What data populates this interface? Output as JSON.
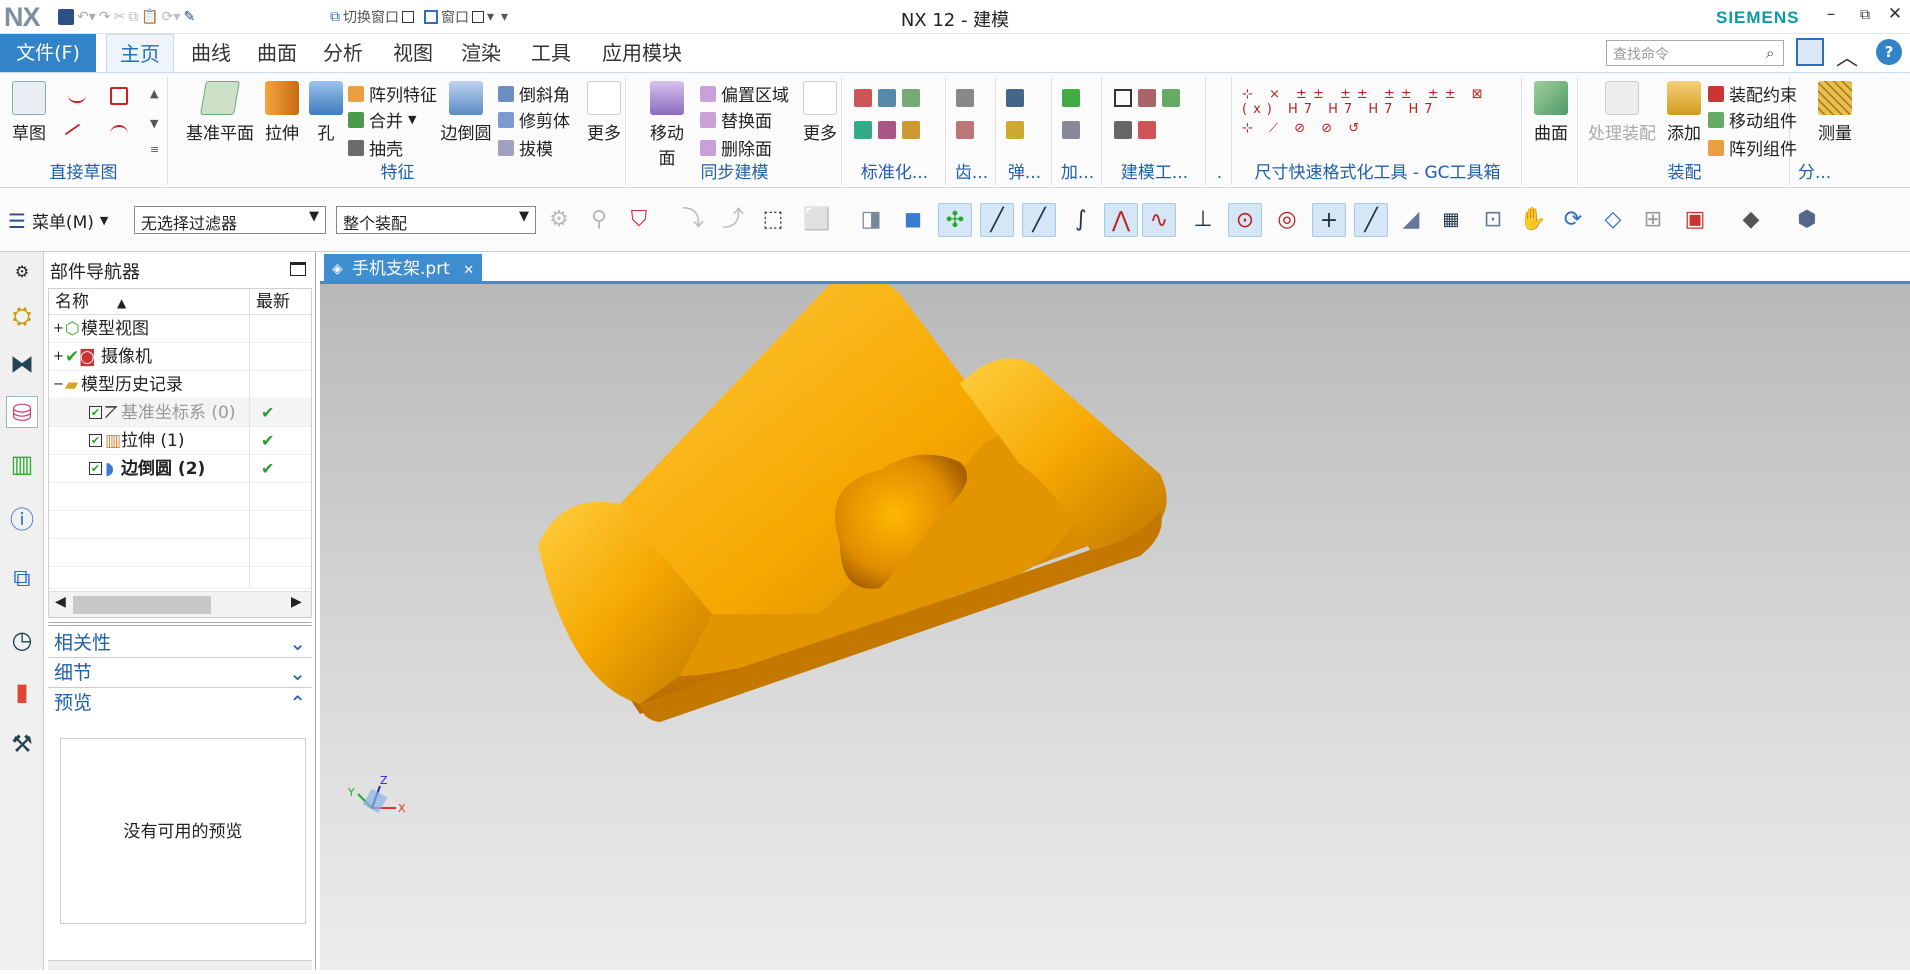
{
  "titlebar": {
    "logo": "NX",
    "title": "NX 12 - 建模",
    "switch_window": "切换窗口",
    "window": "窗口",
    "brand": "SIEMENS"
  },
  "menu": {
    "file": "文件(F)",
    "tabs": [
      "主页",
      "曲线",
      "曲面",
      "分析",
      "视图",
      "渲染",
      "工具",
      "应用模块"
    ],
    "search_placeholder": "查找命令"
  },
  "ribbon": {
    "sketch": {
      "btn": "草图",
      "group": "直接草图"
    },
    "feature": {
      "datum_plane": "基准平面",
      "extrude": "拉伸",
      "hole": "孔",
      "pattern_feature": "阵列特征",
      "unite": "合并",
      "shell": "抽壳",
      "edge_blend": "边倒圆",
      "chamfer": "倒斜角",
      "trim_body": "修剪体",
      "draft": "拔模",
      "more": "更多",
      "group": "特征"
    },
    "sync": {
      "move_face": "移动面",
      "offset_region": "偏置区域",
      "replace_face": "替换面",
      "delete_face": "删除面",
      "more": "更多",
      "group": "同步建模"
    },
    "groups_small": [
      "标准化...",
      "齿...",
      "弹...",
      "加...",
      "建模工...",
      ".",
      "尺寸快速格式化工具 - GC工具箱"
    ],
    "surface": {
      "btn": "曲面"
    },
    "assembly": {
      "process": "处理装配",
      "add": "添加",
      "constraint": "装配约束",
      "move_comp": "移动组件",
      "pattern_comp": "阵列组件",
      "group": "装配"
    },
    "analysis": {
      "measure": "测量",
      "group": "分..."
    }
  },
  "toolbar2": {
    "menu": "菜单(M)",
    "filter": "无选择过滤器",
    "scope": "整个装配"
  },
  "navigator": {
    "title": "部件导航器",
    "col_name": "名称",
    "col_latest": "最新",
    "items": [
      {
        "label": "模型视图",
        "latest": ""
      },
      {
        "label": "摄像机",
        "latest": ""
      },
      {
        "label": "模型历史记录",
        "latest": ""
      },
      {
        "label": "基准坐标系 (0)",
        "latest": "✔"
      },
      {
        "label": "拉伸 (1)",
        "latest": "✔"
      },
      {
        "label": "边倒圆 (2)",
        "latest": "✔"
      }
    ],
    "panels": {
      "dependencies": "相关性",
      "details": "细节",
      "preview": "预览"
    },
    "no_preview": "没有可用的预览"
  },
  "document": {
    "tab": "手机支架.prt",
    "axes": {
      "x": "X",
      "y": "Y",
      "z": "Z"
    }
  },
  "colors": {
    "accent": "#3283c7",
    "model": "#f2a800",
    "brand": "#0d9aa6"
  }
}
